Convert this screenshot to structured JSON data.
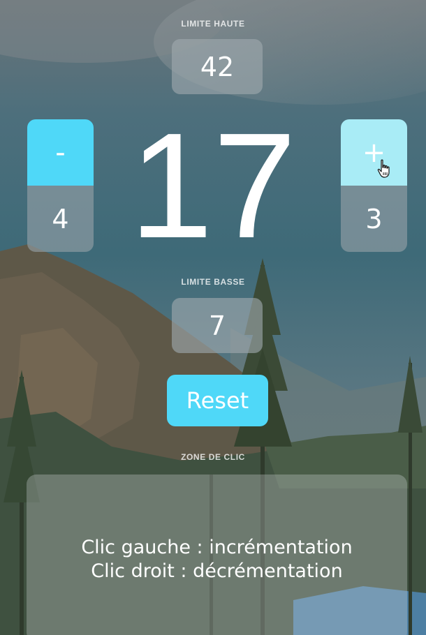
{
  "background": {
    "description_colors": {
      "sky_top": "#6a7378",
      "sky_mid": "#3e6f7f",
      "mountain": "#5b5a4a",
      "forest": "#3b4f3a",
      "lake": "#4d7fa3"
    }
  },
  "upper_limit": {
    "label": "LIMITE HAUTE",
    "value": "42"
  },
  "counter": {
    "value": "17"
  },
  "decrement": {
    "symbol": "-",
    "step": "4",
    "color": "#4fd8f8"
  },
  "increment": {
    "symbol": "+",
    "step": "3",
    "color": "#a9ecf6"
  },
  "lower_limit": {
    "label": "LIMITE BASSE",
    "value": "7"
  },
  "reset": {
    "label": "Reset",
    "color": "#4fd8f8"
  },
  "click_zone": {
    "label": "ZONE DE CLIC",
    "line1": "Clic gauche : incrémentation",
    "line2": "Clic droit : décrémentation"
  },
  "cursor": {
    "icon": "hand-pointer-icon"
  }
}
